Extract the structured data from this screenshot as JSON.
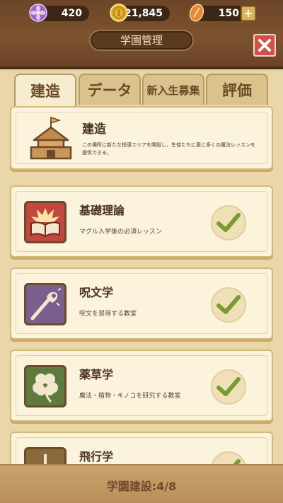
{
  "resources": {
    "gems": "420",
    "coins": "21,845",
    "feathers": "150"
  },
  "header": {
    "title": "学園管理"
  },
  "tabs": [
    {
      "label": "建造",
      "active": true
    },
    {
      "label": "データ",
      "active": false
    },
    {
      "label": "新入生募集",
      "active": false
    },
    {
      "label": "評価",
      "active": false
    }
  ],
  "build_card": {
    "title": "建造",
    "description": "この場所に新たな指導エリアを開設し、生徒たちに更に多くの魔法レッスンを提供できる。"
  },
  "classrooms": [
    {
      "title": "基礎理論",
      "description": "マグル入学後の必須レッスン",
      "built": true,
      "color": "#c2473d"
    },
    {
      "title": "呪文学",
      "description": "呪文を習得する教室",
      "built": true,
      "color": "#7a5f8e"
    },
    {
      "title": "薬草学",
      "description": "魔法・植物・キノコを研究する教室",
      "built": true,
      "color": "#5e7a3e"
    },
    {
      "title": "飛行学",
      "description": "",
      "built": false,
      "color": "#8a6a3a"
    }
  ],
  "footer": {
    "status": "学園建設:4/8"
  }
}
